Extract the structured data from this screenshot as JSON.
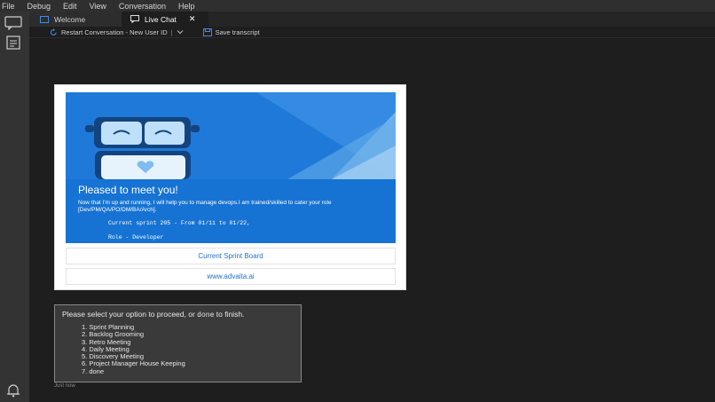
{
  "menu": {
    "items": [
      "File",
      "Debug",
      "Edit",
      "View",
      "Conversation",
      "Help"
    ]
  },
  "tabs": [
    {
      "label": "Welcome",
      "icon": "window-icon"
    },
    {
      "label": "Live Chat",
      "icon": "chat-icon",
      "close": "✕"
    }
  ],
  "toolbar": {
    "restart_label": "Restart Conversation - New User ID",
    "save_label": "Save transcript"
  },
  "card": {
    "title": "Pleased to meet you!",
    "description": "Now that I'm up and running, I will help you to manage devops.I am trained/skilled to cater your role [Dev/PM/QA/PO/DM/BA/Arch].",
    "sprint_line": "Current sprint 205 - From 01/11 to 01/22,",
    "role_line": "Role - Developer",
    "button_board": "Current Sprint Board",
    "button_site": "www.advaita.ai"
  },
  "prompt": {
    "title_prefix": "Please select your option to proceed, or",
    "title_done": "done",
    "title_suffix": "to finish.",
    "options": [
      "1. Sprint Planning",
      "2. Backlog Grooming",
      "3. Retro Meeting",
      "4. Daily Meeting",
      "5. Discovery Meeting",
      "6. Project Manager House Keeping",
      "7. done"
    ]
  },
  "timestamp": "Just now",
  "colors": {
    "accent": "#1f79d8",
    "link": "#1f72c8",
    "background": "#1e1e1e"
  }
}
